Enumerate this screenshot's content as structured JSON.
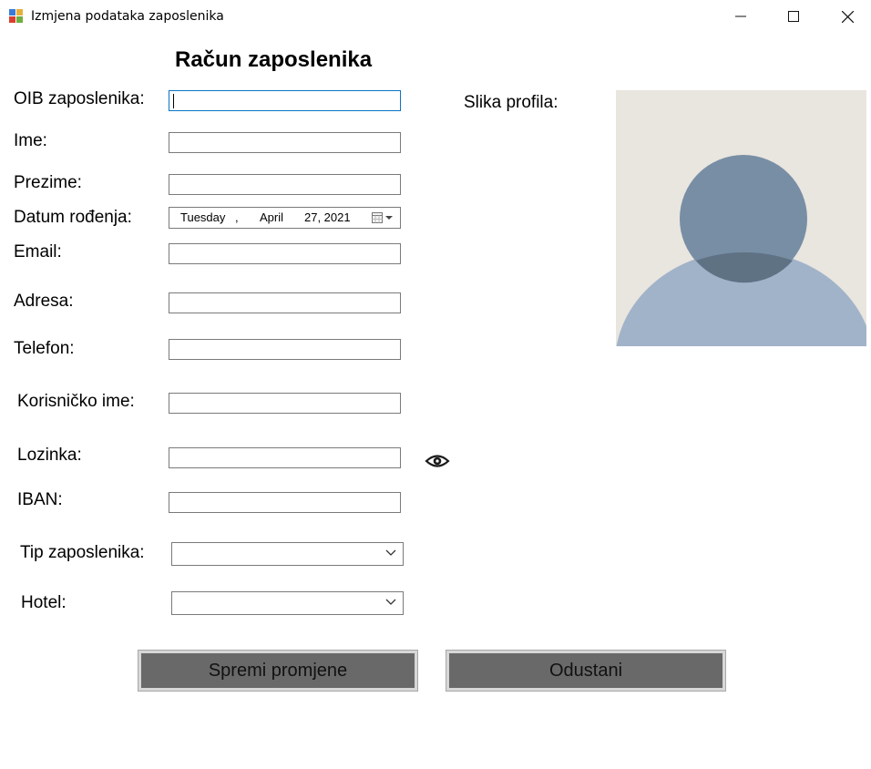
{
  "window": {
    "title": "Izmjena podataka zaposlenika"
  },
  "form": {
    "heading": "Račun zaposlenika",
    "oib_label": "OIB zaposlenika:",
    "ime_label": "Ime:",
    "prezime_label": "Prezime:",
    "datum_label": "Datum rođenja:",
    "datum_value": {
      "day": "Tuesday",
      "sep": ",",
      "month": "April",
      "date": "27, 2021"
    },
    "email_label": "Email:",
    "adresa_label": "Adresa:",
    "telefon_label": "Telefon:",
    "korisnicko_label": "Korisničko ime:",
    "lozinka_label": "Lozinka:",
    "iban_label": "IBAN:",
    "tip_label": "Tip zaposlenika:",
    "hotel_label": "Hotel:",
    "slika_label": "Slika profila:"
  },
  "buttons": {
    "save": "Spremi promjene",
    "cancel": "Odustani"
  },
  "icons": {
    "eye": "eye-icon",
    "calendar": "calendar-icon",
    "dropdown": "chevron-down-icon",
    "avatar": "person-placeholder"
  },
  "colors": {
    "button_bg": "#696969",
    "avatar_bg": "#e9e5df",
    "avatar_head": "#788ea5",
    "avatar_body": "#a1b3c9",
    "focus_border": "#0a74c4"
  }
}
